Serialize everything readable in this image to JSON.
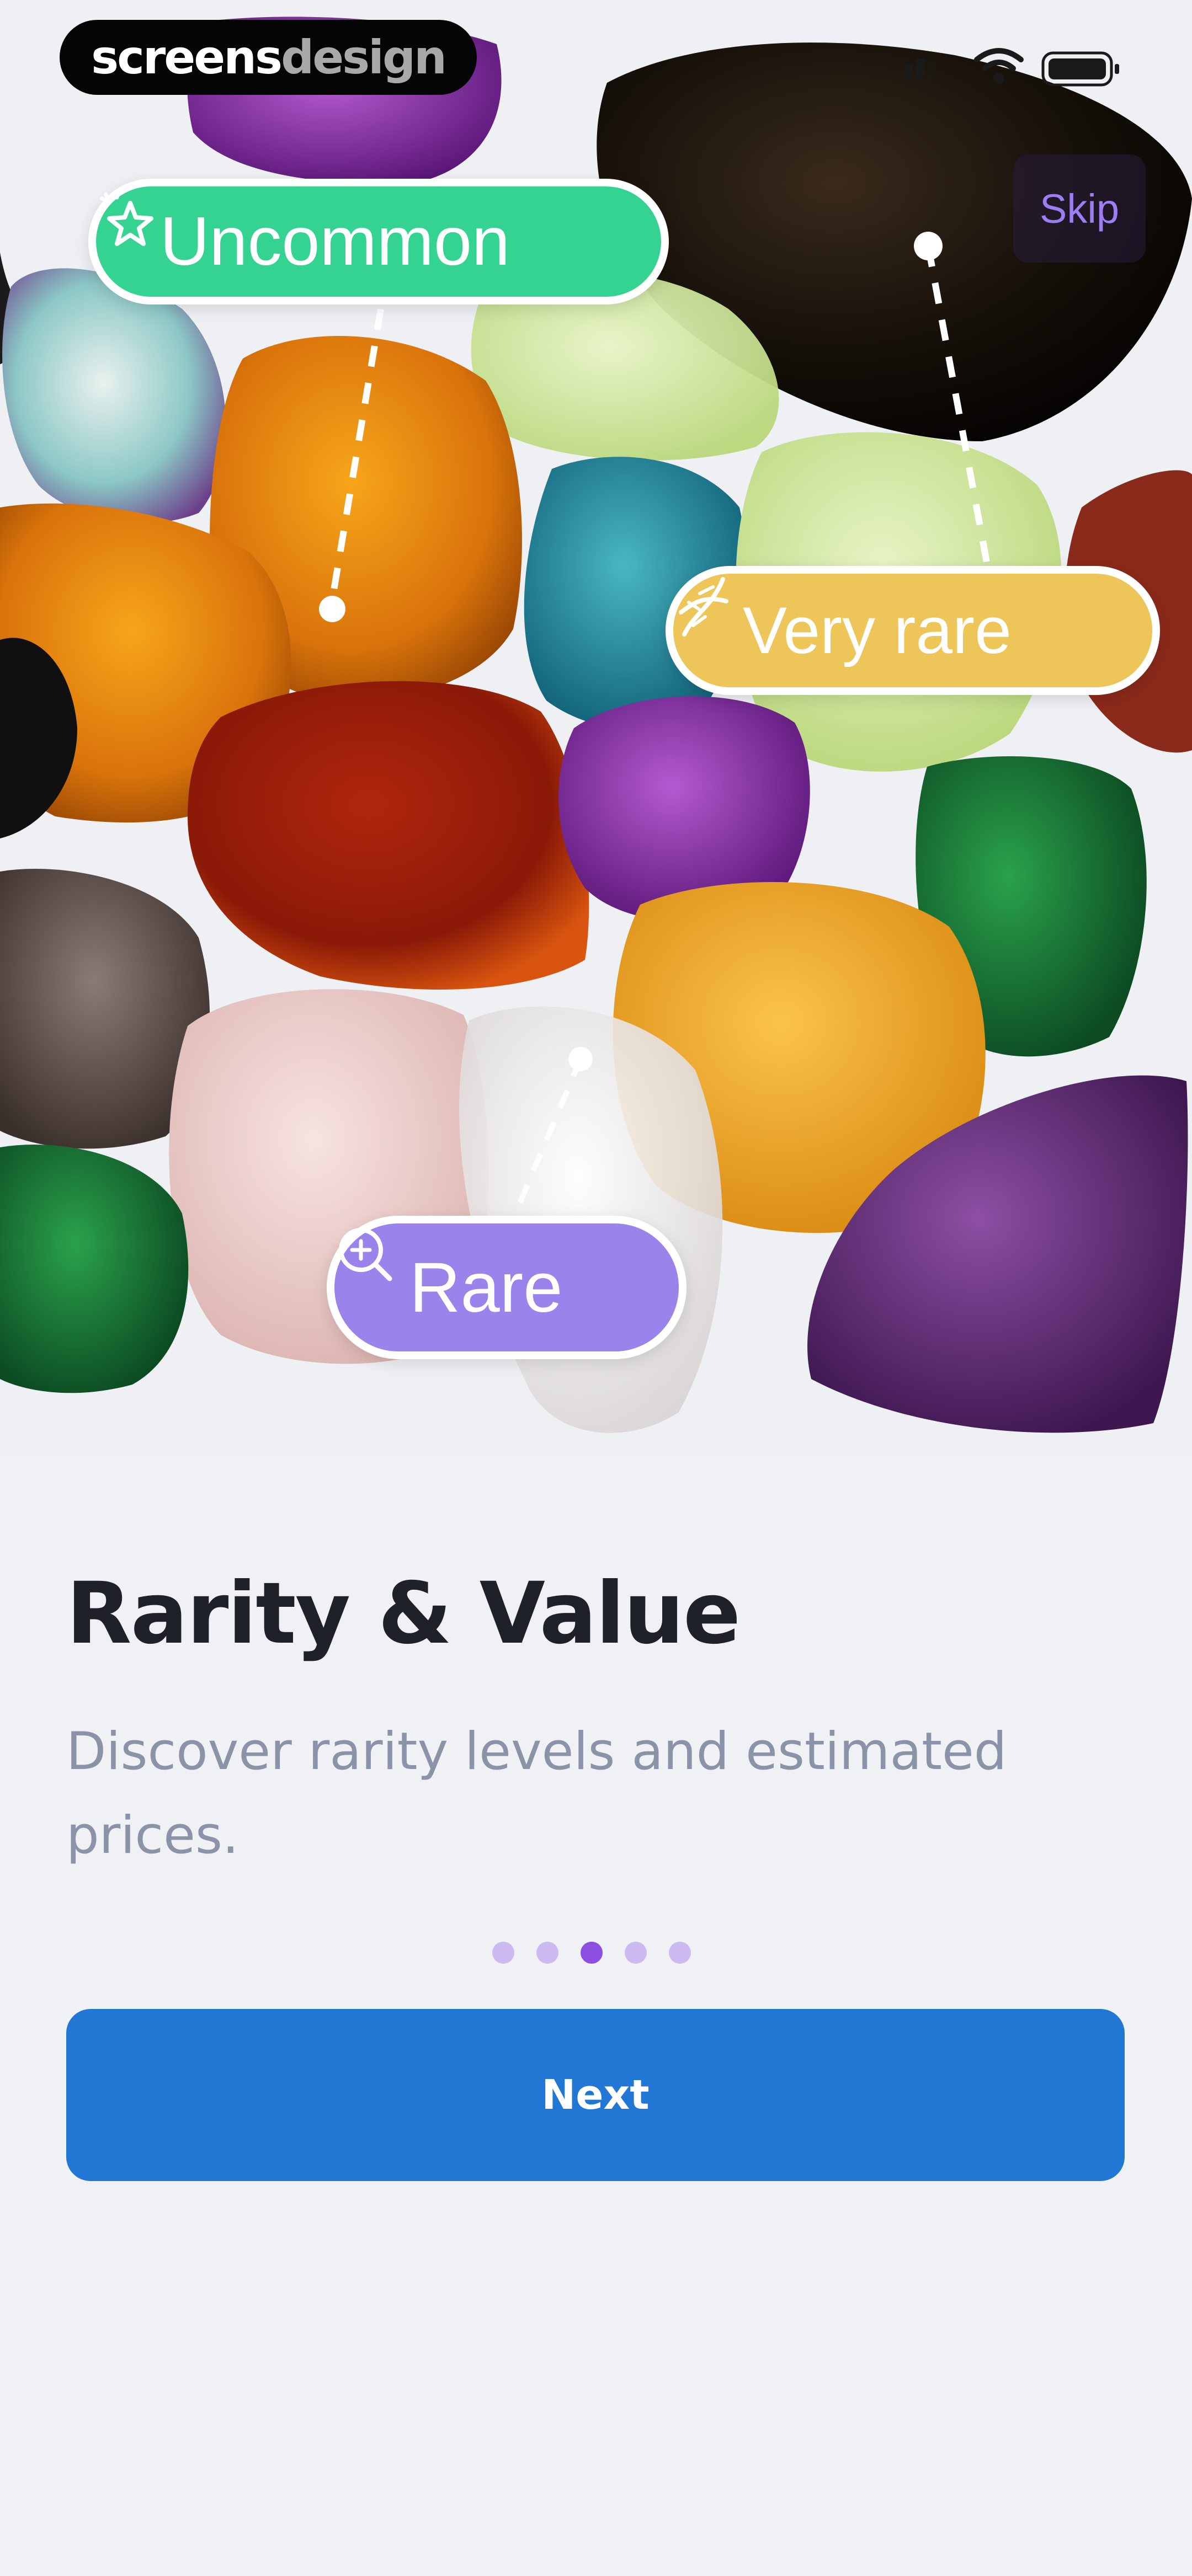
{
  "watermark": {
    "part1": "screens",
    "part2": "design"
  },
  "header": {
    "skip_label": "Skip"
  },
  "tags": {
    "uncommon": {
      "label": "Uncommon",
      "color": "#34d391",
      "icon": "sparkle-star-icon"
    },
    "very_rare": {
      "label": "Very rare",
      "color": "#edc558",
      "icon": "dna-icon"
    },
    "rare": {
      "label": "Rare",
      "color": "#9a83ea",
      "icon": "magnifier-plus-icon"
    }
  },
  "content": {
    "title": "Rarity & Value",
    "subtitle": "Discover rarity levels and estimated prices."
  },
  "pagination": {
    "total": 5,
    "active_index": 2,
    "active_color": "#8b4ee0",
    "inactive_color": "#cdb9f2"
  },
  "actions": {
    "next_label": "Next",
    "next_color": "#2277d4"
  }
}
